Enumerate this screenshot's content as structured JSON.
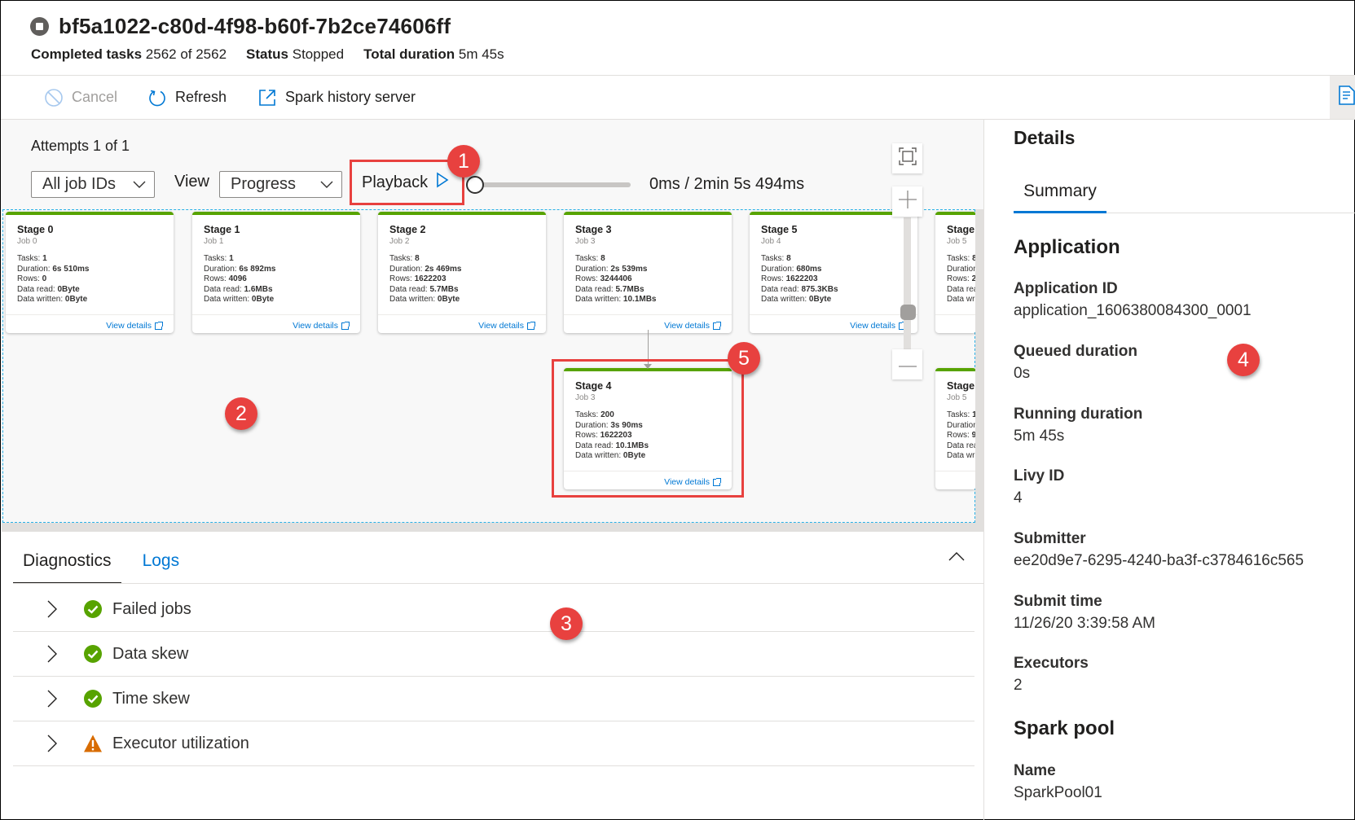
{
  "header": {
    "status_icon": "stop-circle-icon",
    "title": "bf5a1022-c80d-4f98-b60f-7b2ce74606ff",
    "meta": [
      {
        "label": "Completed tasks",
        "value": "2562 of 2562"
      },
      {
        "label": "Status",
        "value": "Stopped"
      },
      {
        "label": "Total duration",
        "value": "5m 45s"
      }
    ]
  },
  "toolbar": {
    "cancel": {
      "label": "Cancel",
      "icon": "cancel-icon",
      "disabled": true
    },
    "refresh": {
      "label": "Refresh",
      "icon": "refresh-icon"
    },
    "history": {
      "label": "Spark history server",
      "icon": "external-link-icon"
    },
    "side_toggle_icon": "document-search-icon"
  },
  "graph": {
    "attempts": "Attempts 1 of 1",
    "job_filter": {
      "selected": "All job IDs"
    },
    "view_label": "View",
    "view_select": {
      "selected": "Progress"
    },
    "playback_label": "Playback",
    "playback_progress": 0,
    "time_readout": "0ms / 2min 5s 494ms",
    "view_details_label": "View details",
    "stat_labels": {
      "tasks": "Tasks:",
      "duration": "Duration:",
      "rows": "Rows:",
      "read": "Data read:",
      "written": "Data written:"
    },
    "stages": [
      {
        "title": "Stage 0",
        "job": "Job 0",
        "tasks": "1",
        "duration": "6s 510ms",
        "rows": "0",
        "read": "0Byte",
        "written": "0Byte"
      },
      {
        "title": "Stage 1",
        "job": "Job 1",
        "tasks": "1",
        "duration": "6s 892ms",
        "rows": "4096",
        "read": "1.6MBs",
        "written": "0Byte"
      },
      {
        "title": "Stage 2",
        "job": "Job 2",
        "tasks": "8",
        "duration": "2s 469ms",
        "rows": "1622203",
        "read": "5.7MBs",
        "written": "0Byte"
      },
      {
        "title": "Stage 3",
        "job": "Job 3",
        "tasks": "8",
        "duration": "2s 539ms",
        "rows": "3244406",
        "read": "5.7MBs",
        "written": "10.1MBs"
      },
      {
        "title": "Stage 5",
        "job": "Job 4",
        "tasks": "8",
        "duration": "680ms",
        "rows": "1622203",
        "read": "875.3KBs",
        "written": "0Byte"
      },
      {
        "title": "Stage",
        "job": "Job 5",
        "tasks": "8",
        "duration": "",
        "rows": "2",
        "read": "",
        "written": "",
        "clipped": true
      },
      {
        "title": "Stage 4",
        "job": "Job 3",
        "tasks": "200",
        "duration": "3s 90ms",
        "rows": "1622203",
        "read": "10.1MBs",
        "written": "0Byte"
      },
      {
        "title": "Stage",
        "job": "Job 5",
        "tasks": "1",
        "duration": "",
        "rows": "9",
        "read": "",
        "written": "",
        "clipped": true
      }
    ],
    "zoom_controls": {
      "fit_icon": "fit-to-screen-icon",
      "zoom_in_icon": "plus-icon",
      "zoom_out_icon": "minus-icon",
      "zoom_level": 0.4
    }
  },
  "diagnostics": {
    "tabs": [
      {
        "label": "Diagnostics",
        "active": true
      },
      {
        "label": "Logs",
        "active": false
      }
    ],
    "items": [
      {
        "label": "Failed jobs",
        "status": "success"
      },
      {
        "label": "Data skew",
        "status": "success"
      },
      {
        "label": "Time skew",
        "status": "success"
      },
      {
        "label": "Executor utilization",
        "status": "warning"
      }
    ],
    "colors": {
      "success": "#57a300",
      "warning": "#d86c00"
    }
  },
  "details": {
    "title": "Details",
    "tab": "Summary",
    "application": {
      "heading": "Application",
      "fields": [
        {
          "label": "Application ID",
          "value": "application_1606380084300_0001"
        },
        {
          "label": "Queued duration",
          "value": "0s"
        },
        {
          "label": "Running duration",
          "value": "5m 45s"
        },
        {
          "label": "Livy ID",
          "value": "4"
        },
        {
          "label": "Submitter",
          "value": "ee20d9e7-6295-4240-ba3f-c3784616c565"
        },
        {
          "label": "Submit time",
          "value": "11/26/20 3:39:58 AM"
        },
        {
          "label": "Executors",
          "value": "2"
        }
      ]
    },
    "spark_pool": {
      "heading": "Spark pool",
      "fields": [
        {
          "label": "Name",
          "value": "SparkPool01"
        }
      ]
    }
  },
  "annotations": [
    "1",
    "2",
    "3",
    "4",
    "5"
  ],
  "colors": {
    "accent": "#0078d4",
    "annotation": "#e8413f",
    "stage_complete": "#57a300"
  }
}
